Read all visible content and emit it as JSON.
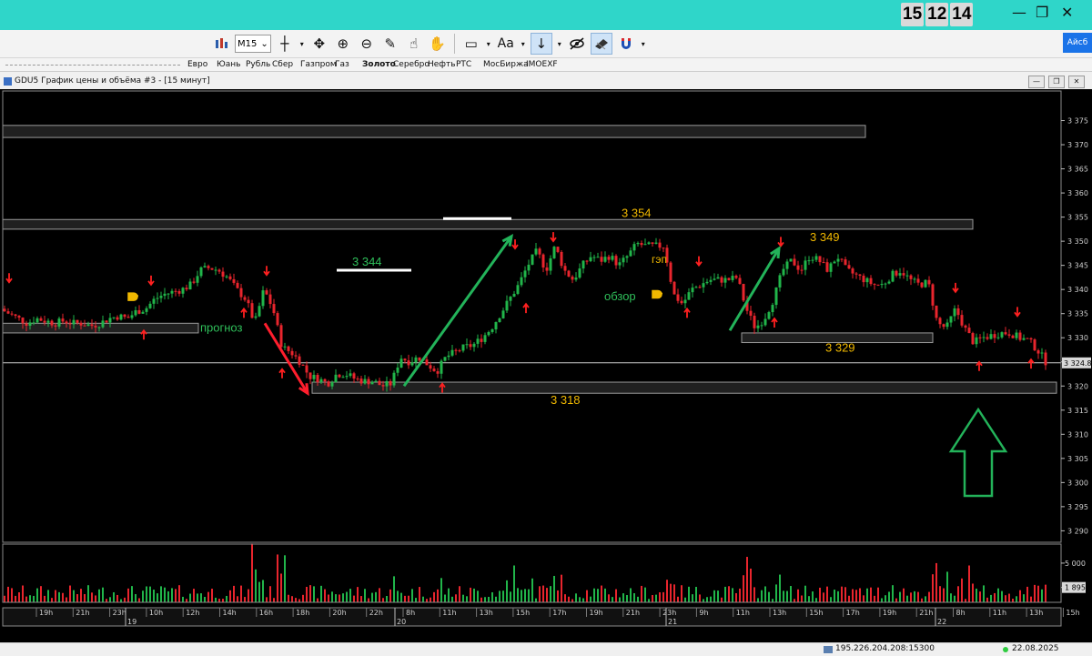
{
  "clock": {
    "h": "15",
    "m": "12",
    "s": "14"
  },
  "window_controls": {
    "minimize": "—",
    "restore": "❐",
    "close": "✕"
  },
  "toolbar": {
    "timeframe": "M15",
    "text_tool": "Aa",
    "account_button": "Айсб"
  },
  "tabs": [
    "Евро",
    "Юань",
    "Рубль",
    "Сбер",
    "Газпром",
    "Газ",
    "Золото",
    "Серебро",
    "Нефть",
    "РТС",
    "МосБиржа",
    "IMOEXF"
  ],
  "active_tab": "Золото",
  "window": {
    "title": "GDU5 График цены и объёма #3 - [15 минут]"
  },
  "status": {
    "ip": "195.226.204.208:15300",
    "date": "22.08.2025"
  },
  "colors": {
    "up": "#21b54a",
    "down": "#e8252d",
    "annotation": "#f0b800",
    "trend_arrow": "#23b35a",
    "background": "#000000"
  },
  "chart_data": {
    "type": "candlestick",
    "symbol": "GDU5",
    "timeframe": "15 минут",
    "ylim": [
      3288,
      3380
    ],
    "y_ticks": [
      3290,
      3295,
      3300,
      3305,
      3310,
      3315,
      3320,
      3325,
      3330,
      3335,
      3340,
      3345,
      3350,
      3355,
      3360,
      3365,
      3370,
      3375
    ],
    "y_tick_labels": [
      "3 290",
      "3 295",
      "3 300",
      "3 305",
      "3 310",
      "3 315",
      "3 320",
      "3 325",
      "3 330",
      "3 335",
      "3 340",
      "3 345",
      "3 350",
      "3 355",
      "3 360",
      "3 365",
      "3 370",
      "3 375"
    ],
    "current_price": 3324.8,
    "current_price_label": "3 324.8",
    "x_labels": [
      "19h",
      "21h",
      "23h",
      "10h",
      "12h",
      "14h",
      "16h",
      "18h",
      "20h",
      "22h",
      "8h",
      "11h",
      "13h",
      "15h",
      "17h",
      "19h",
      "21h",
      "23h",
      "9h",
      "11h",
      "13h",
      "15h",
      "17h",
      "19h",
      "21h",
      "8h",
      "11h",
      "13h",
      "15h"
    ],
    "day_labels": [
      "19",
      "20",
      "21",
      "22"
    ],
    "price_path": [
      [
        0,
        3336
      ],
      [
        10,
        3335
      ],
      [
        20,
        3334
      ],
      [
        30,
        3333
      ],
      [
        40,
        3334
      ],
      [
        50,
        3333.5
      ],
      [
        60,
        3333
      ],
      [
        70,
        3333.5
      ],
      [
        80,
        3333
      ],
      [
        90,
        3333
      ],
      [
        100,
        3332.5
      ],
      [
        110,
        3333
      ],
      [
        120,
        3334
      ],
      [
        130,
        3334.5
      ],
      [
        140,
        3334
      ],
      [
        150,
        3335.5
      ],
      [
        160,
        3336
      ],
      [
        170,
        3338
      ],
      [
        180,
        3339
      ],
      [
        190,
        3339.5
      ],
      [
        200,
        3340
      ],
      [
        210,
        3341
      ],
      [
        220,
        3344
      ],
      [
        230,
        3344.5
      ],
      [
        240,
        3344
      ],
      [
        250,
        3342.5
      ],
      [
        260,
        3340
      ],
      [
        270,
        3338
      ],
      [
        280,
        3333
      ],
      [
        290,
        3340
      ],
      [
        300,
        3336
      ],
      [
        310,
        3328
      ],
      [
        320,
        3327
      ],
      [
        330,
        3325
      ],
      [
        340,
        3322
      ],
      [
        350,
        3321.5
      ],
      [
        360,
        3320.5
      ],
      [
        370,
        3322.5
      ],
      [
        380,
        3322.5
      ],
      [
        390,
        3321.5
      ],
      [
        400,
        3321
      ],
      [
        410,
        3321
      ],
      [
        420,
        3320
      ],
      [
        430,
        3320.5
      ],
      [
        440,
        3326
      ],
      [
        450,
        3325
      ],
      [
        460,
        3326
      ],
      [
        470,
        3324.5
      ],
      [
        480,
        3323
      ],
      [
        490,
        3326
      ],
      [
        500,
        3327
      ],
      [
        510,
        3328
      ],
      [
        520,
        3328.5
      ],
      [
        530,
        3330
      ],
      [
        540,
        3332
      ],
      [
        550,
        3335
      ],
      [
        560,
        3338
      ],
      [
        570,
        3341
      ],
      [
        580,
        3345
      ],
      [
        590,
        3348
      ],
      [
        600,
        3344
      ],
      [
        610,
        3349
      ],
      [
        620,
        3344
      ],
      [
        630,
        3342
      ],
      [
        640,
        3345
      ],
      [
        650,
        3347
      ],
      [
        660,
        3346
      ],
      [
        670,
        3347
      ],
      [
        680,
        3345
      ],
      [
        690,
        3347
      ],
      [
        700,
        3349.5
      ],
      [
        710,
        3349
      ],
      [
        720,
        3349
      ],
      [
        730,
        3349
      ],
      [
        740,
        3339
      ],
      [
        750,
        3337
      ],
      [
        760,
        3340
      ],
      [
        770,
        3341
      ],
      [
        780,
        3342
      ],
      [
        790,
        3342
      ],
      [
        800,
        3342
      ],
      [
        810,
        3342.5
      ],
      [
        820,
        3336
      ],
      [
        830,
        3332
      ],
      [
        840,
        3334
      ],
      [
        850,
        3338
      ],
      [
        860,
        3344
      ],
      [
        870,
        3346
      ],
      [
        880,
        3344
      ],
      [
        890,
        3347
      ],
      [
        900,
        3346
      ],
      [
        910,
        3344
      ],
      [
        920,
        3347
      ],
      [
        930,
        3344
      ],
      [
        940,
        3343
      ],
      [
        950,
        3342
      ],
      [
        960,
        3341
      ],
      [
        970,
        3341
      ],
      [
        980,
        3343
      ],
      [
        990,
        3344
      ],
      [
        1000,
        3342
      ],
      [
        1010,
        3341
      ],
      [
        1020,
        3341.5
      ],
      [
        1030,
        3333
      ],
      [
        1040,
        3332
      ],
      [
        1050,
        3336
      ],
      [
        1060,
        3332
      ],
      [
        1070,
        3329
      ],
      [
        1080,
        3330
      ],
      [
        1090,
        3330.5
      ],
      [
        1100,
        3331
      ],
      [
        1110,
        3331
      ],
      [
        1120,
        3330
      ],
      [
        1130,
        3329.5
      ],
      [
        1140,
        3327.5
      ],
      [
        1150,
        3324.8
      ]
    ],
    "levels": [
      {
        "label": "",
        "low": 3371.5,
        "high": 3374,
        "x_start": 0,
        "x_end": 948
      },
      {
        "label": "3 354",
        "low": 3352.5,
        "high": 3354.5,
        "x_start": 0,
        "x_end": 1066
      },
      {
        "label": "3 344",
        "value": 3344,
        "x_start": 370,
        "x_end": 452
      },
      {
        "label": "3 329",
        "low": 3329,
        "high": 3331,
        "x_start": 812,
        "x_end": 1022
      },
      {
        "label": "3 318",
        "low": 3318.5,
        "high": 3320.8,
        "x_start": 340,
        "x_end": 1158
      },
      {
        "label": "",
        "low": 3331,
        "high": 3333,
        "x_start": 0,
        "x_end": 215
      }
    ],
    "annotations": [
      "3 354",
      "3 344",
      "3 349",
      "3 329",
      "3 318",
      "прогноз",
      "гэп",
      "обзор"
    ],
    "volume": {
      "ylim": [
        0,
        6500
      ],
      "y_ticks": [
        1895,
        5000
      ],
      "y_tick_labels": [
        "1 895",
        "5 000"
      ]
    }
  }
}
